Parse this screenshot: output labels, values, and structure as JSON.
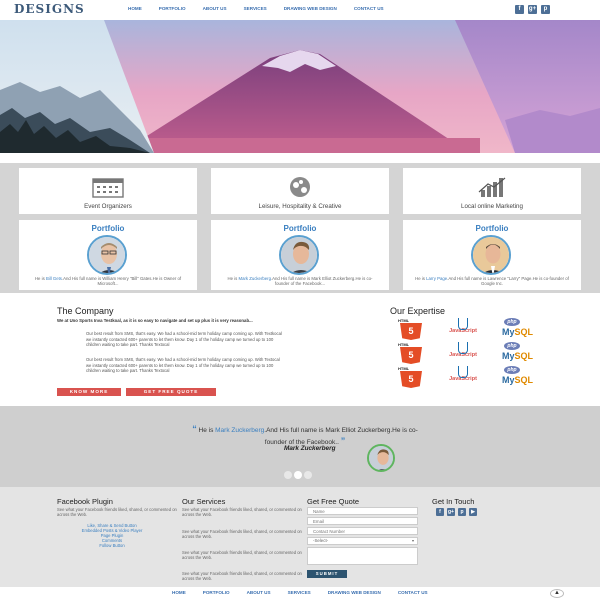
{
  "header": {
    "logo": "DESIGNS",
    "nav": [
      "HOME",
      "PORTFOLIO",
      "ABOUT US",
      "SERVICES",
      "DRAWING WEB DESIGN",
      "CONTACT US"
    ],
    "social": [
      "f",
      "g+",
      "p"
    ]
  },
  "hero": {
    "slide_count": 4
  },
  "services": [
    {
      "icon": "calendar-icon",
      "label": "Event Organizers"
    },
    {
      "icon": "gears-icon",
      "label": "Leisure, Hospitality & Creative"
    },
    {
      "icon": "chart-icon",
      "label": "Local online Marketing"
    }
  ],
  "portfolio": [
    {
      "title": "Portfolio",
      "pre": "He is ",
      "link": "Bill Gets",
      "post": ".And His full name is William Henry \"Bill\" Gates.He is Owner of Microsoft..."
    },
    {
      "title": "Portfolio",
      "pre": "He is ",
      "link": "Mark Zuckerberg",
      "post": ".And His full name is Mark Elliot Zuckerberg.He is co-founder of the Facebook..."
    },
    {
      "title": "Portfolio",
      "pre": "He is ",
      "link": "Larry Page",
      "post": ".And His full name is Lawrence \"Larry\" Page.He is co-founder of Google Inc."
    }
  ],
  "company": {
    "title": "The Company",
    "subtitle": "We at Uno Sports Inva Testkoal, as it is so easy to navigate and set up plus it is very reasonab...",
    "para1": "Our best result from SMS, that's easy. We had a school-mid term holiday camp coming up. With Textkocal we instantly contacted 600+ parents to let them know. Day 1 of the holiday camp we turned up to 100 children waiting to take part. Thanks Textocal",
    "para2": "Our best result from SMS, that's easy. We had a school-mid term holiday camp coming up. With Textocal we instantly contacted 600+ parents to let them know. Day 1 of the holiday camp we turned up to 100 children waiting to take part. Thanks Textocal",
    "know_more": "KNOW MORE",
    "get_quote": "GET FREE QUOTE"
  },
  "expertise": {
    "title": "Our Expertise",
    "html5_label": "HTML",
    "html5_num": "5",
    "js_label": "JavaScript",
    "php_label": "php",
    "mysql_my": "My",
    "mysql_sql": "SQL"
  },
  "testimonial": {
    "quote_mark": "“",
    "pre": "He is ",
    "link": "Mark Zuckerberg",
    "post": ".And His full name is Mark Elliot Zuckerberg.He is co-founder of the Facebook..",
    "close_mark": "”",
    "name": "Mark Zuckerberg"
  },
  "footer": {
    "fb_title": "Facebook Plugin",
    "fb_text": "See what your Facebook friends liked, shared, or commented on across the Web.",
    "fb_links": [
      "Like, Share & Send Button",
      "Embedded Posts & Video Player",
      "Page Plugin",
      "Comments",
      "Follow Button"
    ],
    "services_title": "Our Services",
    "services_text": "See what your Facebook friends liked, shared, or commented on across the Web.",
    "quote_title": "Get Free Quote",
    "name_placeholder": "Name",
    "email_placeholder": "Email",
    "phone_placeholder": "Contact Number",
    "select_value": "-Select-",
    "submit": "SUBMIT",
    "touch_title": "Get In Touch",
    "touch_social": [
      "f",
      "g+",
      "p",
      "▶"
    ]
  },
  "bottom_nav": [
    "HOME",
    "PORTFOLIO",
    "ABOUT US",
    "SERVICES",
    "DRAWING WEB DESIGN",
    "CONTACT US"
  ],
  "colors": {
    "accent": "#3a7fc0",
    "red": "#d9534f",
    "navy": "#2d5470"
  }
}
